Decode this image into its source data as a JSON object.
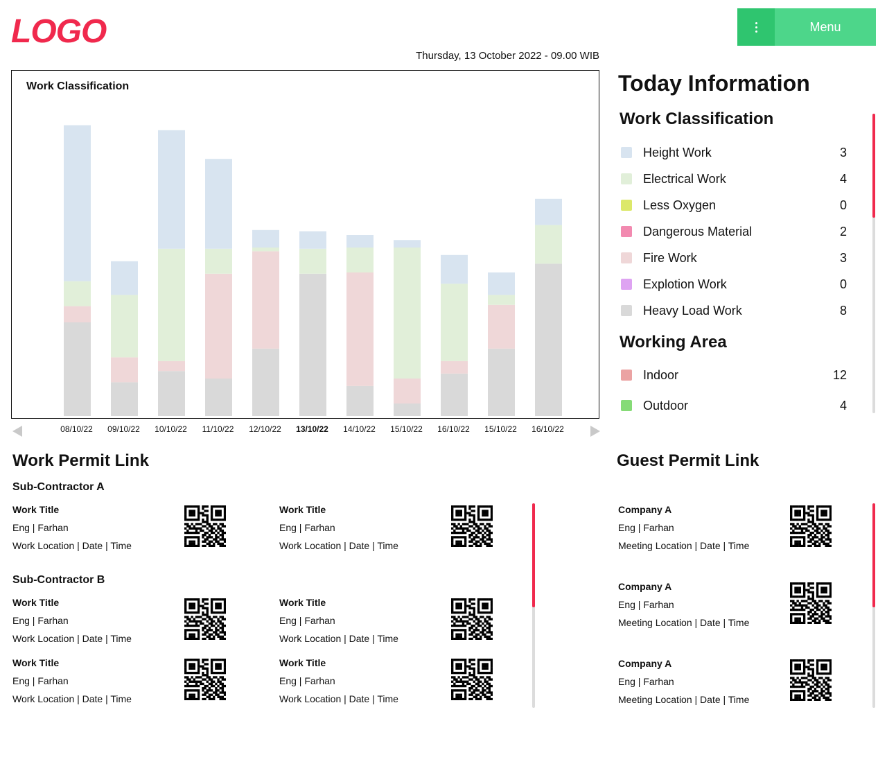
{
  "header": {
    "logo": "LOGO",
    "menu_label": "Menu",
    "menu_icon": "kebab-vertical-icon",
    "datetime": "Thursday, 13 October 2022 - 09.00 WIB"
  },
  "colors": {
    "brand": "#f0294d",
    "menu_green": "#4dd68a",
    "menu_green_dark": "#2fc56f",
    "height_work": "#d8e4f0",
    "electrical_work": "#e1efd9",
    "less_oxygen": "#dce86a",
    "dangerous_material": "#f28ab0",
    "fire_work": "#efd7d8",
    "explotion_work": "#dea3f2",
    "heavy_load_work": "#d9d9d9",
    "indoor": "#eba3a3",
    "outdoor": "#86db77"
  },
  "chart_data": {
    "type": "bar",
    "stacked": true,
    "title": "Work Classification",
    "categories": [
      "08/10/22",
      "09/10/22",
      "10/10/22",
      "11/10/22",
      "12/10/22",
      "13/10/22",
      "14/10/22",
      "15/10/22",
      "16/10/22",
      "15/10/22",
      "16/10/22"
    ],
    "highlighted_category": "13/10/22",
    "series": [
      {
        "name": "Heavy Load Work",
        "color": "#d9d9d9",
        "values": [
          7.5,
          2.7,
          3.6,
          3.0,
          5.4,
          11.4,
          2.4,
          1.0,
          3.4,
          5.4,
          12.2
        ]
      },
      {
        "name": "Fire Work",
        "color": "#efd7d8",
        "values": [
          1.3,
          2.0,
          0.8,
          8.4,
          7.8,
          0,
          9.1,
          2.0,
          1.0,
          3.5,
          0
        ]
      },
      {
        "name": "Electrical Work",
        "color": "#e1efd9",
        "values": [
          2.0,
          5.0,
          9.0,
          2.0,
          0.3,
          2.0,
          2.0,
          10.5,
          6.2,
          0.8,
          3.1
        ]
      },
      {
        "name": "Height Work",
        "color": "#d8e4f0",
        "values": [
          12.5,
          2.7,
          9.5,
          7.2,
          1.4,
          1.4,
          1.0,
          0.6,
          2.3,
          1.8,
          2.1
        ]
      }
    ],
    "ylim": [
      0,
      25
    ],
    "grid": false,
    "legend": "none",
    "nav": {
      "prev_icon": "arrow-left-icon",
      "next_icon": "arrow-right-icon"
    }
  },
  "today": {
    "title": "Today Information",
    "work_classification": {
      "title": "Work Classification",
      "items": [
        {
          "label": "Height Work",
          "count": "3"
        },
        {
          "label": "Electrical Work",
          "count": "4"
        },
        {
          "label": "Less Oxygen",
          "count": "0"
        },
        {
          "label": "Dangerous Material",
          "count": "2"
        },
        {
          "label": "Fire Work",
          "count": "3"
        },
        {
          "label": "Explotion Work",
          "count": "0"
        },
        {
          "label": "Heavy Load Work",
          "count": "8"
        }
      ]
    },
    "working_area": {
      "title": "Working Area",
      "items": [
        {
          "label": "Indoor",
          "count": "12"
        },
        {
          "label": "Outdoor",
          "count": "4"
        }
      ]
    }
  },
  "work_permit": {
    "title": "Work Permit Link",
    "groups": [
      {
        "name": "Sub-Contractor A",
        "cards": [
          {
            "title": "Work Title",
            "eng": "Eng | Farhan",
            "loc": "Work Location | Date | Time"
          },
          {
            "title": "Work Title",
            "eng": "Eng | Farhan",
            "loc": "Work Location | Date | Time"
          }
        ]
      },
      {
        "name": "Sub-Contractor B",
        "cards": [
          {
            "title": "Work Title",
            "eng": "Eng | Farhan",
            "loc": "Work Location | Date | Time"
          },
          {
            "title": "Work Title",
            "eng": "Eng | Farhan",
            "loc": "Work Location | Date | Time"
          },
          {
            "title": "Work Title",
            "eng": "Eng | Farhan",
            "loc": "Work Location | Date | Time"
          },
          {
            "title": "Work Title",
            "eng": "Eng | Farhan",
            "loc": "Work Location | Date | Time"
          }
        ]
      }
    ]
  },
  "guest_permit": {
    "title": "Guest Permit Link",
    "cards": [
      {
        "title": "Company A",
        "eng": "Eng | Farhan",
        "loc": "Meeting Location | Date | Time"
      },
      {
        "title": "Company A",
        "eng": "Eng | Farhan",
        "loc": "Meeting Location | Date | Time"
      },
      {
        "title": "Company A",
        "eng": "Eng | Farhan",
        "loc": "Meeting Location | Date | Time"
      }
    ]
  },
  "qr_icon": "qr-code-icon"
}
